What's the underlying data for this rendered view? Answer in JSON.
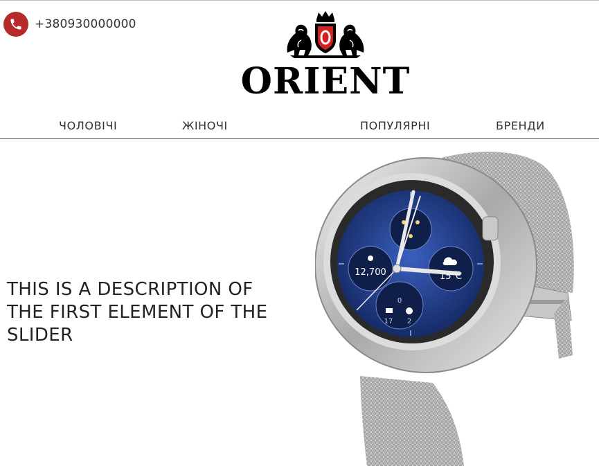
{
  "header": {
    "phone_icon": "phone-icon",
    "phone_number": "+380930000000",
    "brand_name": "ORIENT",
    "logo_icon": "orient-crest-icon"
  },
  "nav": {
    "items": [
      {
        "label": "ЧОЛОВІЧІ"
      },
      {
        "label": "ЖІНОЧІ"
      },
      {
        "label": "ПОПУЛЯРНІ"
      },
      {
        "label": "БРЕНДИ"
      }
    ]
  },
  "slider": {
    "caption": "THIS IS A DESCRIPTION OF THE FIRST ELEMENT OF THE SLIDER",
    "image": "smartwatch-image",
    "watch_face": {
      "left_dial": "12,700",
      "right_dial": "15°C",
      "bottom_left": "17",
      "bottom_right": "2",
      "bottom_top": "0"
    }
  },
  "colors": {
    "accent": "#b52a2a",
    "text": "#333333",
    "dial": "#1f3a8a"
  }
}
